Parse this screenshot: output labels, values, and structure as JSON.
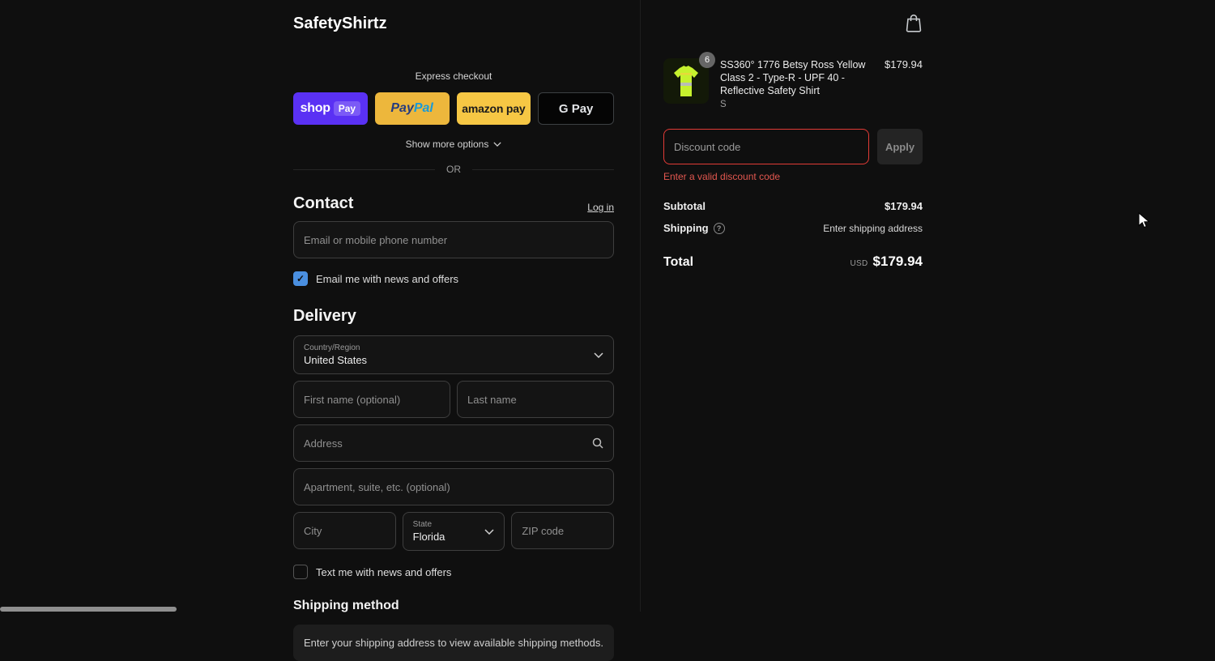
{
  "header": {
    "store_name": "SafetyShirtz"
  },
  "express": {
    "label": "Express checkout",
    "shop_pay": {
      "brand": "shop",
      "pay": "Pay"
    },
    "paypal": {
      "pay": "Pay",
      "pal": "Pal"
    },
    "amazon": {
      "label": "amazon pay"
    },
    "google": {
      "label": "G Pay"
    },
    "show_more": "Show more options",
    "or": "OR"
  },
  "contact": {
    "title": "Contact",
    "login": "Log in",
    "email_placeholder": "Email or mobile phone number",
    "news_label": "Email me with news and offers",
    "news_checked": true,
    "check_glyph": "✓"
  },
  "delivery": {
    "title": "Delivery",
    "country_label": "Country/Region",
    "country_value": "United States",
    "first_name_placeholder": "First name (optional)",
    "last_name_placeholder": "Last name",
    "address_placeholder": "Address",
    "apartment_placeholder": "Apartment, suite, etc. (optional)",
    "city_placeholder": "City",
    "state_label": "State",
    "state_value": "Florida",
    "zip_placeholder": "ZIP code",
    "text_label": "Text me with news and offers",
    "text_checked": false
  },
  "shipping_method": {
    "title": "Shipping method",
    "notice": "Enter your shipping address to view available shipping methods."
  },
  "summary": {
    "item": {
      "quantity": "6",
      "title": "SS360° 1776 Betsy Ross Yellow Class 2 - Type-R - UPF 40 - Reflective Safety Shirt",
      "variant": "S",
      "price": "$179.94"
    },
    "discount": {
      "placeholder": "Discount code",
      "apply_label": "Apply",
      "error": "Enter a valid discount code"
    },
    "subtotal_label": "Subtotal",
    "subtotal_value": "$179.94",
    "shipping_label": "Shipping",
    "shipping_info_glyph": "?",
    "shipping_value": "Enter shipping address",
    "total_label": "Total",
    "currency": "USD",
    "total_value": "$179.94"
  },
  "colors": {
    "page_bg": "#0f0f0f",
    "shop_pay_purple": "#5a31f4",
    "paypal_gold": "#edb73c",
    "amazon_yellow": "#f6c744",
    "error_red": "#e23b36",
    "checkbox_blue": "#4a8fe0",
    "hivis_green": "#c6f22e"
  }
}
